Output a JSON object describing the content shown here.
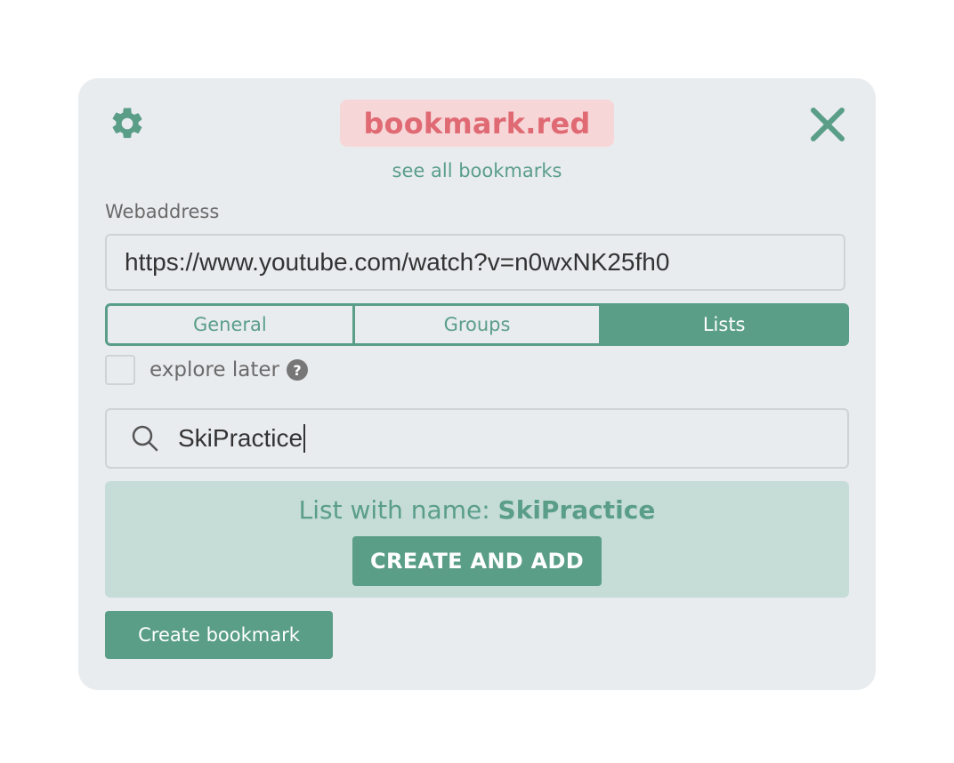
{
  "header": {
    "logo_text": "bookmark.red",
    "see_all_link": "see all bookmarks",
    "settings_icon": "gear-icon",
    "close_icon": "close-icon"
  },
  "form": {
    "webaddress_label": "Webaddress",
    "webaddress_value": "https://www.youtube.com/watch?v=n0wxNK25fh0"
  },
  "tabs": [
    {
      "label": "General",
      "active": false
    },
    {
      "label": "Groups",
      "active": false
    },
    {
      "label": "Lists",
      "active": true
    }
  ],
  "explore_later": {
    "label": "explore later",
    "checked": false,
    "help_glyph": "?"
  },
  "search": {
    "icon": "search-icon",
    "value": "SkiPractice"
  },
  "result": {
    "prefix": "List with name: ",
    "name": "SkiPractice",
    "button_label": "CREATE AND ADD"
  },
  "footer": {
    "create_label": "Create bookmark"
  },
  "colors": {
    "accent": "#5a9e88",
    "logo_bg": "#f7d6d8",
    "logo_text": "#e06a73",
    "panel_bg": "#e9ecef",
    "result_bg": "#c5dcd7"
  }
}
